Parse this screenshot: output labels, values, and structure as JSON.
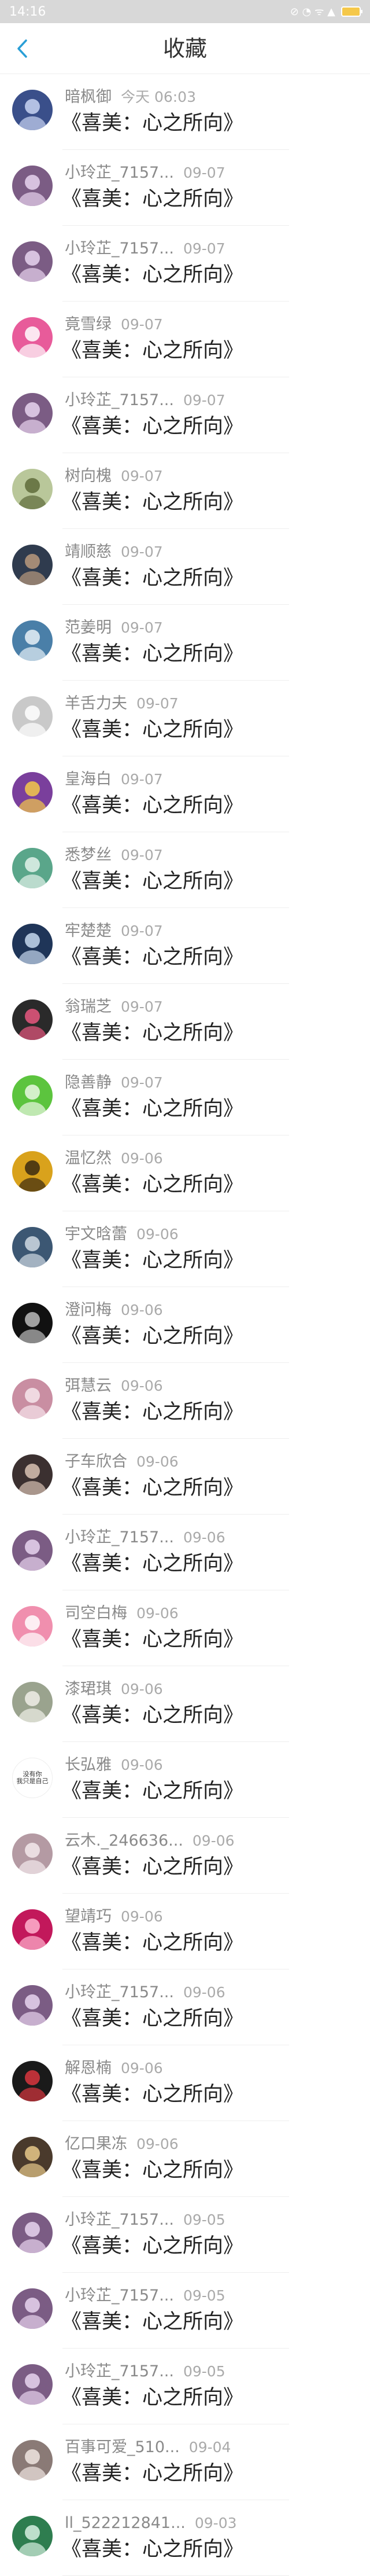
{
  "status_bar": {
    "time": "14:16",
    "icons_text": "⊘ ◔ ᯤ ▲"
  },
  "header": {
    "title": "收藏",
    "back_icon": "chevron-left-icon",
    "accent": "#2a9fd6"
  },
  "work_title": "《喜美：心之所向》",
  "items": [
    {
      "nickname": "暗枫御",
      "date": "今天 06:03",
      "avatar_bg": "#3a4f8a",
      "avatar_fg": "#c9d4f2"
    },
    {
      "nickname": "小玲芷_7157...",
      "date": "09-07",
      "avatar_bg": "#7b5c84",
      "avatar_fg": "#e8d3ee"
    },
    {
      "nickname": "小玲芷_7157...",
      "date": "09-07",
      "avatar_bg": "#7b5c84",
      "avatar_fg": "#e8d3ee"
    },
    {
      "nickname": "竟雪绿",
      "date": "09-07",
      "avatar_bg": "#e85b9a",
      "avatar_fg": "#ffffff"
    },
    {
      "nickname": "小玲芷_7157...",
      "date": "09-07",
      "avatar_bg": "#7b5c84",
      "avatar_fg": "#e8d3ee"
    },
    {
      "nickname": "树向槐",
      "date": "09-07",
      "avatar_bg": "#b9c79a",
      "avatar_fg": "#5e6b3a"
    },
    {
      "nickname": "靖顺慈",
      "date": "09-07",
      "avatar_bg": "#2f3b4e",
      "avatar_fg": "#b89a7e"
    },
    {
      "nickname": "范姜明",
      "date": "09-07",
      "avatar_bg": "#4a7fa8",
      "avatar_fg": "#e6f0f7"
    },
    {
      "nickname": "羊舌力夫",
      "date": "09-07",
      "avatar_bg": "#c9c9c9",
      "avatar_fg": "#ffffff"
    },
    {
      "nickname": "皇海白",
      "date": "09-07",
      "avatar_bg": "#7a3f9c",
      "avatar_fg": "#f4c94a"
    },
    {
      "nickname": "悉梦丝",
      "date": "09-07",
      "avatar_bg": "#5aa68a",
      "avatar_fg": "#e3f2ea"
    },
    {
      "nickname": "牢楚楚",
      "date": "09-07",
      "avatar_bg": "#1f3558",
      "avatar_fg": "#c6d8ee"
    },
    {
      "nickname": "翁瑞芝",
      "date": "09-07",
      "avatar_bg": "#2a2a2a",
      "avatar_fg": "#e8577f"
    },
    {
      "nickname": "隐善静",
      "date": "09-07",
      "avatar_bg": "#5cc43e",
      "avatar_fg": "#e9f8e3"
    },
    {
      "nickname": "温忆然",
      "date": "09-06",
      "avatar_bg": "#d9a21c",
      "avatar_fg": "#3a2a10"
    },
    {
      "nickname": "宇文晗蕾",
      "date": "09-06",
      "avatar_bg": "#3c5773",
      "avatar_fg": "#cfd9e3"
    },
    {
      "nickname": "澄问梅",
      "date": "09-06",
      "avatar_bg": "#111111",
      "avatar_fg": "#bbbbbb"
    },
    {
      "nickname": "弭慧云",
      "date": "09-06",
      "avatar_bg": "#c98ea2",
      "avatar_fg": "#f7e6ec"
    },
    {
      "nickname": "子车欣合",
      "date": "09-06",
      "avatar_bg": "#3b3030",
      "avatar_fg": "#d9c2b3"
    },
    {
      "nickname": "小玲芷_7157...",
      "date": "09-06",
      "avatar_bg": "#7b5c84",
      "avatar_fg": "#e8d3ee"
    },
    {
      "nickname": "司空白梅",
      "date": "09-06",
      "avatar_bg": "#f08fae",
      "avatar_fg": "#ffffff"
    },
    {
      "nickname": "漆珺琪",
      "date": "09-06",
      "avatar_bg": "#9aa38e",
      "avatar_fg": "#f0efe8"
    },
    {
      "nickname": "长弘雅",
      "date": "09-06",
      "avatar_bg": "#ffffff",
      "avatar_fg": "#333333",
      "avatar_text": "没有你\n我只是自己"
    },
    {
      "nickname": "云木._246636...",
      "date": "09-06",
      "avatar_bg": "#b49aa3",
      "avatar_fg": "#f3e9ec"
    },
    {
      "nickname": "望靖巧",
      "date": "09-06",
      "avatar_bg": "#c2185b",
      "avatar_fg": "#ffb3cf"
    },
    {
      "nickname": "小玲芷_7157...",
      "date": "09-06",
      "avatar_bg": "#7b5c84",
      "avatar_fg": "#e8d3ee"
    },
    {
      "nickname": "解恩楠",
      "date": "09-06",
      "avatar_bg": "#1a1a1a",
      "avatar_fg": "#d9363e"
    },
    {
      "nickname": "亿口果冻",
      "date": "09-06",
      "avatar_bg": "#4a3a2c",
      "avatar_fg": "#e7c98a"
    },
    {
      "nickname": "小玲芷_7157...",
      "date": "09-05",
      "avatar_bg": "#7b5c84",
      "avatar_fg": "#e8d3ee"
    },
    {
      "nickname": "小玲芷_7157...",
      "date": "09-05",
      "avatar_bg": "#7b5c84",
      "avatar_fg": "#e8d3ee"
    },
    {
      "nickname": "小玲芷_7157...",
      "date": "09-05",
      "avatar_bg": "#7b5c84",
      "avatar_fg": "#e8d3ee"
    },
    {
      "nickname": "百事可爱_510...",
      "date": "09-04",
      "avatar_bg": "#8a7a76",
      "avatar_fg": "#efe5e1"
    },
    {
      "nickname": "ll_522212841...",
      "date": "09-03",
      "avatar_bg": "#2e7d4f",
      "avatar_fg": "#d6efe0"
    }
  ]
}
